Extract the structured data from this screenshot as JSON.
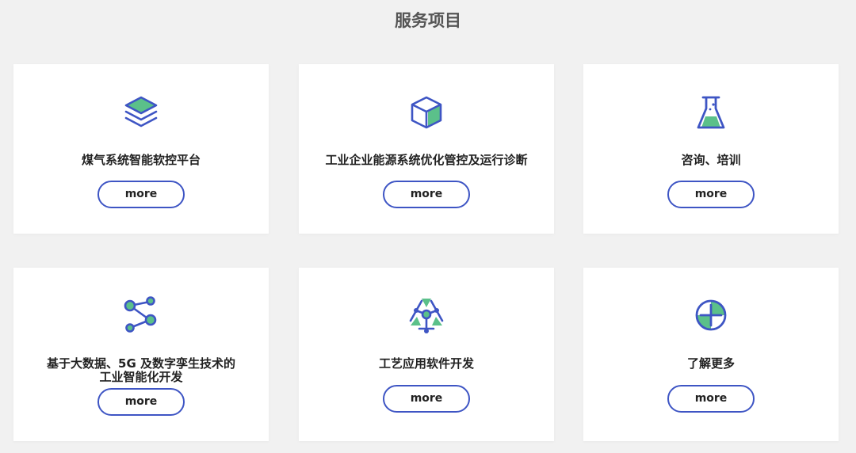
{
  "section": {
    "title": "服务项目"
  },
  "colors": {
    "accent_blue": "#3e55c4",
    "accent_green": "#5bc08a",
    "background": "#f1f1f1",
    "card": "#ffffff"
  },
  "cards": [
    {
      "title": "煤气系统智能软控平台",
      "button": "more",
      "icon": "layers-icon"
    },
    {
      "title": "工业企业能源系统优化管控及运行诊断",
      "button": "more",
      "icon": "cube-icon"
    },
    {
      "title": "咨询、培训",
      "button": "more",
      "icon": "flask-icon"
    },
    {
      "title_line1": "基于大数据、5G 及数字孪生技术的",
      "title_line2": "工业智能化开发",
      "button": "more",
      "icon": "share-nodes-icon"
    },
    {
      "title": "工艺应用软件开发",
      "button": "more",
      "icon": "network-triangle-icon"
    },
    {
      "title": "了解更多",
      "button": "more",
      "icon": "plus-circle-icon"
    }
  ]
}
